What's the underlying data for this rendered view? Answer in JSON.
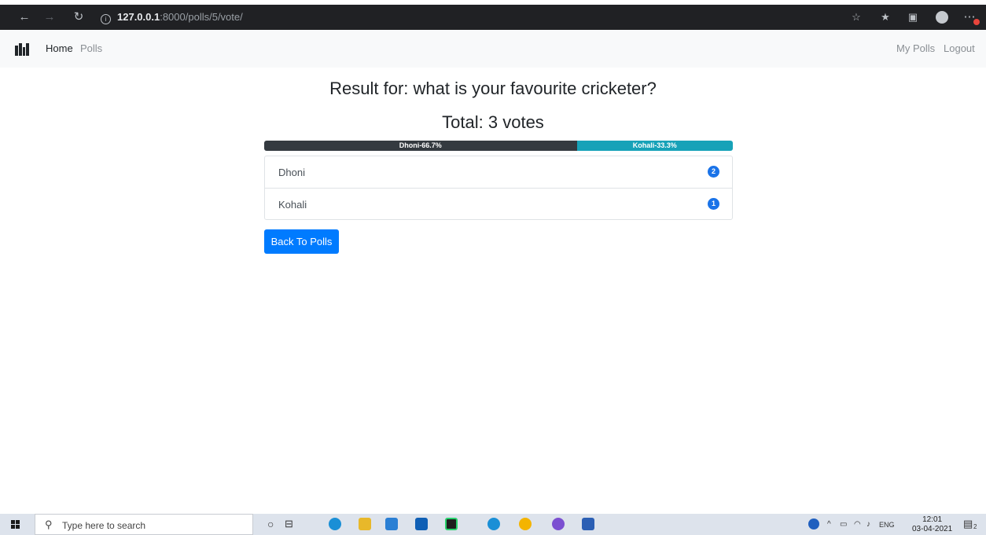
{
  "browser": {
    "url_host": "127.0.0.1",
    "url_rest": ":8000/polls/5/vote/",
    "icons": [
      "back-arrow-icon",
      "forward-arrow-icon",
      "reload-icon",
      "info-icon",
      "star-icon",
      "favorites-icon",
      "collections-icon",
      "profile-avatar",
      "more-icon"
    ]
  },
  "nav": {
    "home": "Home",
    "polls": "Polls",
    "my_polls": "My Polls",
    "logout": "Logout"
  },
  "result": {
    "title": "Result for: what is your favourite cricketer?",
    "total": "Total: 3 votes",
    "bars": [
      {
        "label": "Dhoni-66.7%",
        "percent": 66.7,
        "color": "#343a40"
      },
      {
        "label": "Kohali-33.3%",
        "percent": 33.3,
        "color": "#17a2b8"
      }
    ],
    "choices": [
      {
        "name": "Dhoni",
        "votes": "2"
      },
      {
        "name": "Kohali",
        "votes": "1"
      }
    ],
    "back_label": "Back To Polls"
  },
  "taskbar": {
    "search_placeholder": "Type here to search",
    "lang": "ENG",
    "time": "12:01",
    "date": "03-04-2021",
    "notification_count": "2"
  },
  "colors": {
    "primary": "#007bff",
    "badge": "#1a73e8",
    "navbar": "#f8f9fa",
    "browser_chrome": "#202124"
  }
}
